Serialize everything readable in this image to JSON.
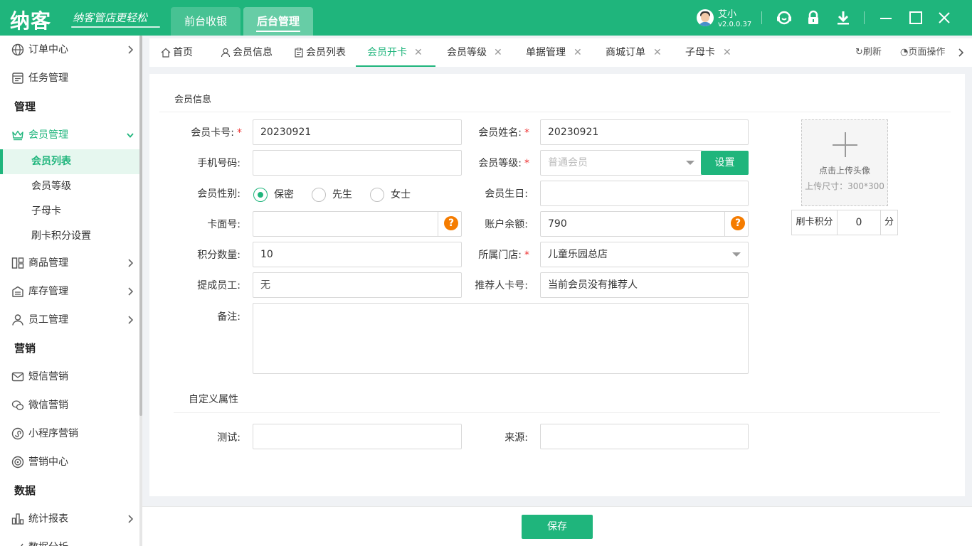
{
  "app": {
    "logo": "纳客",
    "slogan": "纳客管店更轻松",
    "top_tabs": [
      "前台收银",
      "后台管理"
    ],
    "user_name": "艾小",
    "version": "v2.0.0.37"
  },
  "colors": {
    "brand": "#1fb57c",
    "warning": "#f57c00",
    "required": "#e33333"
  },
  "sidebar": {
    "items": [
      {
        "label": "订单中心",
        "icon": "globe-icon"
      },
      {
        "label": "任务管理",
        "icon": "task-icon"
      },
      {
        "section": "管理"
      },
      {
        "label": "会员管理",
        "icon": "crown-icon"
      },
      {
        "sub": "会员列表"
      },
      {
        "sub": "会员等级"
      },
      {
        "sub": "子母卡"
      },
      {
        "sub": "刷卡积分设置"
      },
      {
        "label": "商品管理",
        "icon": "goods-icon"
      },
      {
        "label": "库存管理",
        "icon": "warehouse-icon"
      },
      {
        "label": "员工管理",
        "icon": "user-icon"
      },
      {
        "section": "营销"
      },
      {
        "label": "短信营销",
        "icon": "mail-icon"
      },
      {
        "label": "微信营销",
        "icon": "wechat-icon"
      },
      {
        "label": "小程序营销",
        "icon": "miniprogram-icon"
      },
      {
        "label": "营销中心",
        "icon": "target-icon"
      },
      {
        "section": "数据"
      },
      {
        "label": "统计报表",
        "icon": "bar-chart-icon"
      },
      {
        "label": "数据分析",
        "icon": "analysis-icon"
      }
    ]
  },
  "tabs": [
    {
      "label": "首页"
    },
    {
      "label": "会员信息"
    },
    {
      "label": "会员列表"
    },
    {
      "label": "会员开卡"
    },
    {
      "label": "会员等级"
    },
    {
      "label": "单据管理"
    },
    {
      "label": "商城订单"
    },
    {
      "label": "子母卡"
    }
  ],
  "tab_tools": {
    "refresh": "刷新",
    "page_ops": "页面操作"
  },
  "form": {
    "section_title": "会员信息",
    "card_no_label": "会员卡号:",
    "card_no_value": "20230921",
    "name_label": "会员姓名:",
    "name_value": "20230921",
    "phone_label": "手机号码:",
    "phone_value": "",
    "level_label": "会员等级:",
    "level_value": "普通会员",
    "level_button": "设置",
    "gender_label": "会员性别:",
    "gender_options": [
      "保密",
      "先生",
      "女士"
    ],
    "birthday_label": "会员生日:",
    "birthday_value": "",
    "face_no_label": "卡面号:",
    "face_no_value": "",
    "balance_label": "账户余额:",
    "balance_value": "790",
    "points_label": "积分数量:",
    "points_value": "10",
    "store_label": "所属门店:",
    "store_value": "儿童乐园总店",
    "staff_label": "提成员工:",
    "staff_value": "无",
    "referrer_label": "推荐人卡号:",
    "referrer_value": "当前会员没有推荐人",
    "remark_label": "备注:",
    "remark_value": "",
    "custom_title": "自定义属性",
    "test_label": "测试:",
    "test_value": "",
    "source_label": "来源:",
    "source_value": "",
    "help_mark": "?",
    "required_mark": "*"
  },
  "avatar_upload": {
    "line1": "点击上传头像",
    "line2": "上传尺寸：300*300"
  },
  "card_points": {
    "label": "刷卡积分",
    "value": "0",
    "unit": "分"
  },
  "footer": {
    "save": "保存"
  }
}
